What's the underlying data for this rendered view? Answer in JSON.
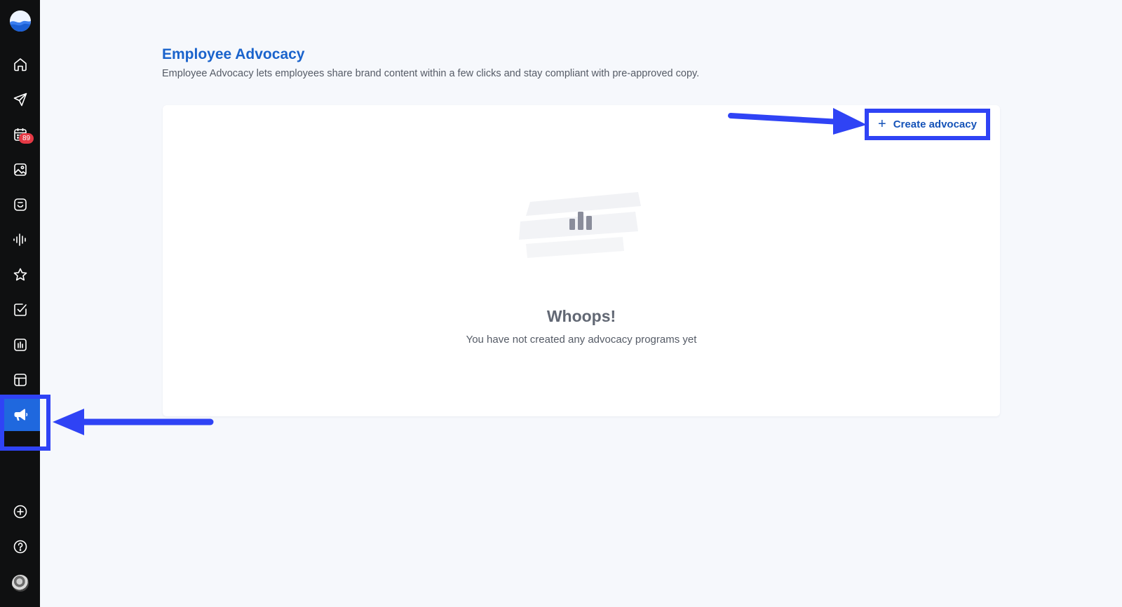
{
  "sidebar": {
    "items": [
      {
        "name": "home",
        "icon": "home-icon"
      },
      {
        "name": "publish",
        "icon": "paper-plane-icon"
      },
      {
        "name": "planner",
        "icon": "calendar-icon",
        "badge": "89"
      },
      {
        "name": "media",
        "icon": "image-icon"
      },
      {
        "name": "inbox",
        "icon": "inbox-icon"
      },
      {
        "name": "listening",
        "icon": "waveform-icon"
      },
      {
        "name": "reviews",
        "icon": "star-icon"
      },
      {
        "name": "tasks",
        "icon": "checkbox-icon"
      },
      {
        "name": "analytics",
        "icon": "bar-chart-icon"
      },
      {
        "name": "layouts",
        "icon": "layout-icon"
      },
      {
        "name": "employee-advocacy",
        "icon": "megaphone-icon",
        "active": true
      }
    ],
    "bottom": [
      {
        "name": "add",
        "icon": "plus-circle-icon"
      },
      {
        "name": "help",
        "icon": "question-circle-icon"
      },
      {
        "name": "profile",
        "icon": "avatar"
      }
    ]
  },
  "page": {
    "title": "Employee Advocacy",
    "description": "Employee Advocacy lets employees share brand content within a few clicks and stay compliant with pre-approved copy."
  },
  "card": {
    "create_button": "Create advocacy",
    "empty_title": "Whoops!",
    "empty_subtitle": "You have not created any advocacy programs yet"
  },
  "colors": {
    "accent": "#1a63cc",
    "active_nav": "#1f68de",
    "annotation": "#2f43f5",
    "badge": "#e53945",
    "sidebar_bg": "#0f1011",
    "page_bg": "#f6f8fc"
  }
}
